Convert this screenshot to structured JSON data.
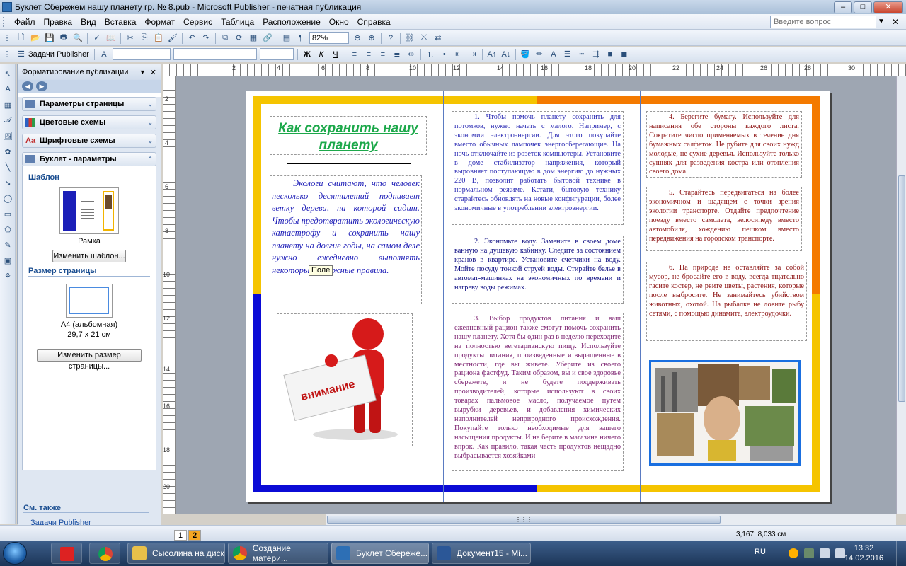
{
  "window": {
    "title": "Буклет Сбережем нашу планету гр. № 8.pub - Microsoft Publisher - печатная публикация",
    "controls": [
      "–",
      "□",
      "✕"
    ]
  },
  "menu": {
    "items": [
      "Файл",
      "Правка",
      "Вид",
      "Вставка",
      "Формат",
      "Сервис",
      "Таблица",
      "Расположение",
      "Окно",
      "Справка"
    ],
    "help_placeholder": "Введите вопрос"
  },
  "toolbar": {
    "zoom": "82%",
    "tasks_label": "Задачи Publisher",
    "bold": "Ж",
    "italic": "К",
    "underline": "Ч"
  },
  "taskpane": {
    "title": "Форматирование публикации",
    "sections": [
      "Параметры страницы",
      "Цветовые схемы",
      "Шрифтовые схемы",
      "Буклет - параметры"
    ],
    "template_heading": "Шаблон",
    "template_name": "Рамка",
    "change_template": "Изменить шаблон...",
    "page_size_heading": "Размер страницы",
    "page_size_name": "A4 (альбомная)",
    "page_size_dims": "29,7 x 21 см",
    "change_page_size": "Изменить размер страницы...",
    "see_also": "См. также",
    "link_tasks": "Задачи Publisher"
  },
  "rulers": {
    "h": [
      "2",
      "4",
      "6",
      "8",
      "10",
      "12",
      "14",
      "16",
      "18",
      "20",
      "22",
      "24",
      "26",
      "28",
      "30"
    ],
    "v": [
      "2",
      "4",
      "6",
      "8",
      "10",
      "12",
      "14",
      "16",
      "18",
      "20"
    ]
  },
  "document": {
    "heading": "Как сохранить нашу планету",
    "intro": "Экологи считают, что человек несколько десятилетий подпивает ветку дерева, на которой сидит. Чтобы предотвратить экологическую катастрофу и сохранить нашу планету на долгие годы, на самом деле нужно ежедневно выполнять некоторые неложные правила.",
    "tooltip": "Поле",
    "image_label": "внимание",
    "tip1": "1. Чтобы помочь планету сохранить для потомков, нужно начать с малого. Например, с экономии электроэнергии. Для этого покупайте вместо обычных лампочек энергосберегающие. На ночь отключайте из розеток компьютеры. Установите в доме стабилизатор напряжения, который выровняет поступающую в дом энергию до нужных 220 В, позволит работать бытовой технике в нормальном режиме. Кстати, бытовую технику старайтесь обновлять на новые конфигурации, более экономичные в употреблении электроэнергии.",
    "tip2": "2. Экономьте воду. Замените в своем доме ванную на душевую кабинку. Следите за состоянием кранов в квартире. Установите счетчики на воду. Мойте посуду тонкой струей воды. Стирайте белье в автомат-машинках на экономичных по времени и нагреву воды режимах.",
    "tip3": "3. Выбор продуктов питания и ваш ежедневный рацион также смогут помочь сохранить нашу планету. Хотя бы один раз в неделю переходите на полностью вегетарианскую пищу. Используйте продукты питания, произведенные и выращенные в местности, где вы живете. Уберите из своего рациона фастфуд. Таким образом, вы и свое здоровье сбережете, и не будете поддерживать производителей, которые используют в своих товарах пальмовое масло, получаемое путем вырубки деревьев, и добавления химических наполнителей неприродного происхождения. Покупайте только необходимые для вашего насыщения продукты. И не берите в магазине ничего впрок. Как правило, такая часть продуктов нещадно выбрасывается хозяйками",
    "tip4": "4. Берегите бумагу. Используйте для написания обе стороны каждого листа. Сократите число применяемых в течение дня бумажных салфеток. Не рубите для своих нужд молодые, не сухие деревья. Используйте только сушняк для разведения костра или отопления своего дома.",
    "tip5": "5. Старайтесь передвигаться на более экономичном и щадящем с точки зрения экологии транспорте. Отдайте предпочтение поезду вместо самолета, велосипеду вместо автомобиля, хождению пешком вместо передвижения на городском транспорте.",
    "tip6": "6. На природе не оставляйте за собой мусор, не бросайте его в воду, всегда тщательно гасите костер, не рвите цветы, растения, которые после выбросите. Не занимайтесь убийством животных, охотой. На рыбалке не ловите рыбу сетями, с помощью динамита, электроудочки."
  },
  "status": {
    "pages": [
      "1",
      "2"
    ],
    "coords": "3,167; 8,033 см"
  },
  "taskbar": {
    "tasks": [
      "Сысолина на диск",
      "Создание матери...",
      "Буклет Сбереже...",
      "Документ15 - Mi..."
    ],
    "lang": "RU",
    "time": "13:32",
    "date": "14.02.2016"
  },
  "colors": {
    "frame_yellow": "#f5c400",
    "frame_orange": "#f47a00",
    "frame_blue": "#0b0bd6",
    "heading_green": "#1ca84a",
    "intro_blue": "#2121b8"
  }
}
